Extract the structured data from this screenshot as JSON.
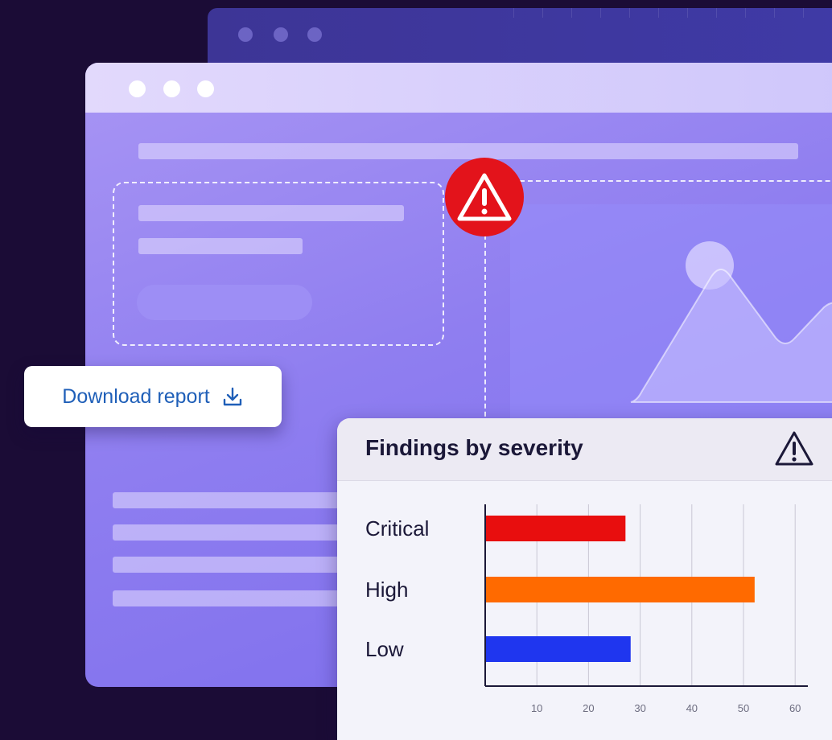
{
  "download": {
    "label": "Download report",
    "icon": "download-icon"
  },
  "alert": {
    "icon": "warning-triangle-icon",
    "color": "#e3131b"
  },
  "findings": {
    "title": "Findings by severity",
    "header_icon": "warning-triangle-icon"
  },
  "chart_data": {
    "type": "bar",
    "orientation": "horizontal",
    "title": "Findings by severity",
    "categories": [
      "Critical",
      "High",
      "Low"
    ],
    "values": [
      27,
      52,
      28
    ],
    "colors": [
      "#e80e0e",
      "#ff6a00",
      "#1f36ef"
    ],
    "x_ticks": [
      10,
      20,
      30,
      40,
      50,
      60
    ],
    "xlim": [
      0,
      63
    ],
    "grid": true,
    "xlabel": "",
    "ylabel": ""
  }
}
